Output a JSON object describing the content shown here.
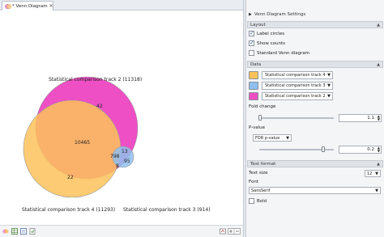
{
  "tab": {
    "title": "* Venn Diagram",
    "close": "✕"
  },
  "venn": {
    "labels": {
      "track2": "Statistical comparison track 2 (11318)",
      "track4": "Statistical comparison track 4 (11293)",
      "track3": "Statistical comparison track 3 (914)"
    },
    "counts": {
      "only2": "42",
      "two_and_four": "10465",
      "only4": "22",
      "all_three": "798",
      "two_and_three": "13",
      "four_and_three": "8",
      "only3": "95"
    },
    "colors": {
      "pink": "#ee4fc4",
      "orange": "#fbc25b",
      "blue": "#8fbfee"
    }
  },
  "settings": {
    "title": "Venn Diagram Settings",
    "layout": {
      "header": "Layout",
      "label_circles": "Label circles",
      "show_counts": "Show counts",
      "standard_venn": "Standard Venn diagram"
    },
    "data": {
      "header": "Data",
      "tracks": [
        {
          "label": "Statistical comparison track 4",
          "color": "#fbc25b"
        },
        {
          "label": "Statistical comparison track 3",
          "color": "#8fbfee"
        },
        {
          "label": "Statistical comparison track 2",
          "color": "#ee4fc4"
        }
      ],
      "fold_change_label": "Fold change",
      "fold_change_value": "1.1",
      "pvalue_label": "P-value",
      "pvalue_type": "FDR p-value",
      "pvalue_value": "0.2"
    },
    "text_format": {
      "header": "Text format",
      "text_size_label": "Text size",
      "text_size_value": "12",
      "font_label": "Font",
      "font_value": "SansSerif",
      "bold_label": "Bold"
    }
  }
}
